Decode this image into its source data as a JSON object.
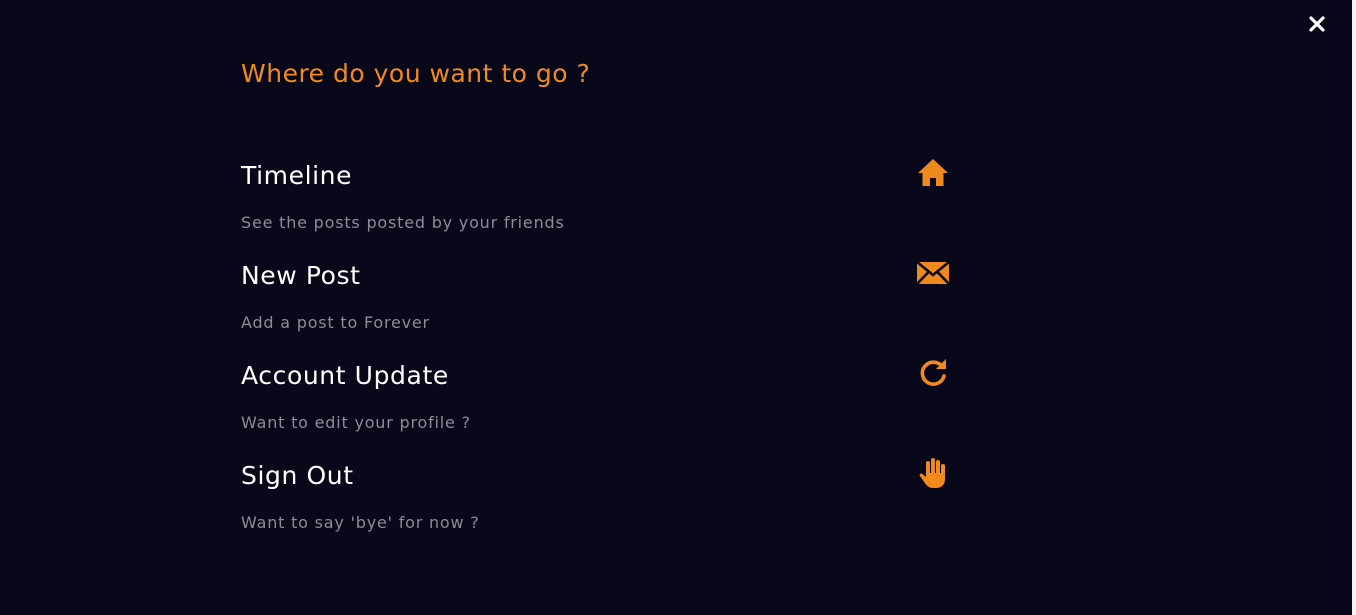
{
  "menu": {
    "heading": "Where do you want to go ?",
    "accent_color": "#f08a1e",
    "items": [
      {
        "title": "Timeline",
        "description": "See the posts posted by your friends",
        "icon": "home-icon"
      },
      {
        "title": "New Post",
        "description": "Add a post to Forever",
        "icon": "envelope-icon"
      },
      {
        "title": "Account Update",
        "description": "Want to edit your profile ?",
        "icon": "refresh-icon"
      },
      {
        "title": "Sign Out",
        "description": "Want to say 'bye' for now ?",
        "icon": "hand-icon"
      }
    ]
  },
  "close": {
    "icon": "close-icon"
  }
}
